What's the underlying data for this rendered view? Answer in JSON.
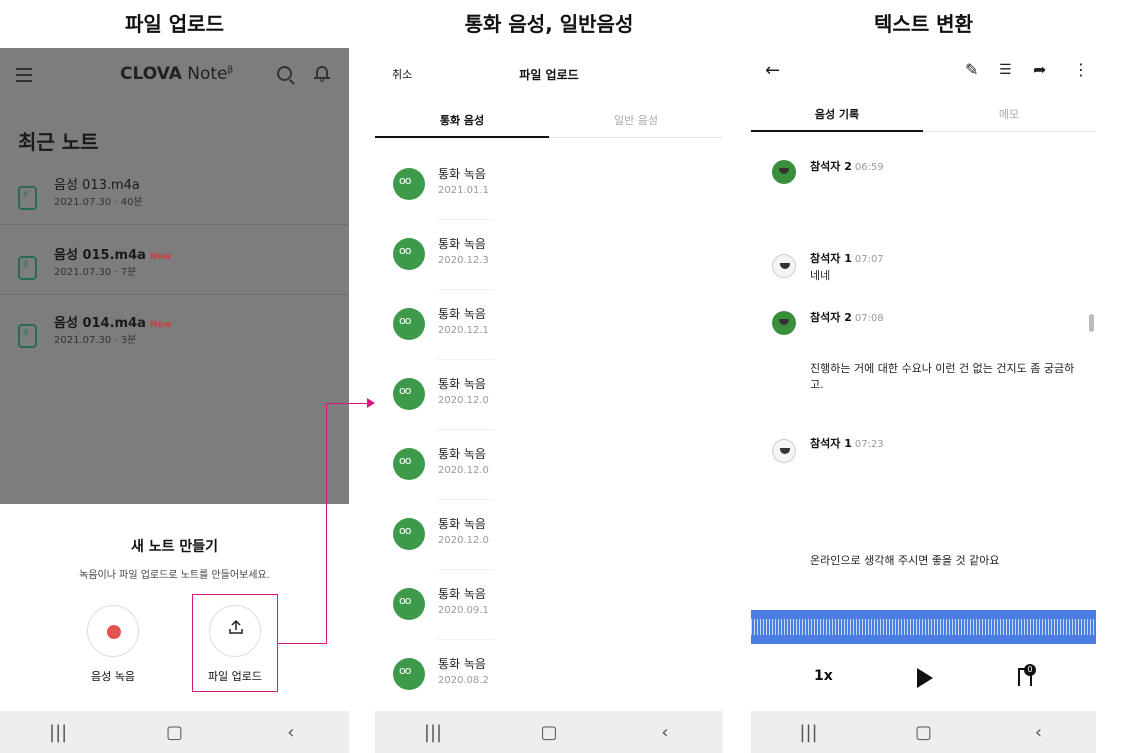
{
  "captions": {
    "upload": "파일 업로드",
    "call": "통화 음성, 일반음성",
    "text": "텍스트 변환"
  },
  "panel1": {
    "app_title_bold": "CLOVA",
    "app_title_rest": "Note",
    "app_title_sup": "β",
    "recent_heading": "최근 노트",
    "notes": [
      {
        "title": "음성 013.m4a",
        "meta": "2021.07.30 · 40분",
        "new": ""
      },
      {
        "title": "음성 015.m4a",
        "meta": "2021.07.30 · 7분",
        "new": "New"
      },
      {
        "title": "음성 014.m4a",
        "meta": "2021.07.30 · 3분",
        "new": "New"
      }
    ],
    "sheet_title": "새 노트 만들기",
    "sheet_subtitle": "녹음이나 파일 업로드로 노트를 만들어보세요.",
    "record_label": "음성 녹음",
    "upload_label": "파일 업로드"
  },
  "panel2": {
    "cancel": "취소",
    "title": "파일 업로드",
    "tab_call": "통화 음성",
    "tab_normal": "일반 음성",
    "calls": [
      {
        "title": "통화 녹음",
        "date": "2021.01.1"
      },
      {
        "title": "통화 녹음",
        "date": "2020.12.3"
      },
      {
        "title": "통화 녹음",
        "date": "2020.12.1"
      },
      {
        "title": "통화 녹음",
        "date": "2020.12.0"
      },
      {
        "title": "통화 녹음",
        "date": "2020.12.0"
      },
      {
        "title": "통화 녹음",
        "date": "2020.12.0"
      },
      {
        "title": "통화 녹음",
        "date": "2020.09.1"
      },
      {
        "title": "통화 녹음",
        "date": "2020.08.2"
      }
    ]
  },
  "panel3": {
    "tab_record": "음성 기록",
    "tab_memo": "메모",
    "speakers": [
      {
        "name": "참석자 2",
        "time": "06:59",
        "avatar": "frog"
      },
      {
        "name": "참석자 1",
        "time": "07:07",
        "avatar": "face"
      },
      {
        "name": "참석자 2",
        "time": "07:08",
        "avatar": "frog"
      },
      {
        "name": "참석자 1",
        "time": "07:23",
        "avatar": "face"
      }
    ],
    "utterances": [
      "네네",
      "진행하는 거에 대한 수요나 이런 건 없는 건지도 좀 궁금하",
      "고.",
      "온라인으로 생각해 주시면 좋을 것 같아요"
    ],
    "speed": "1x",
    "bookmark_count": "0"
  },
  "colors": {
    "accent_green": "#3d9a4a",
    "wave_blue": "#4a7ee0",
    "highlight": "#d4187f",
    "record_red": "#e5514f"
  }
}
